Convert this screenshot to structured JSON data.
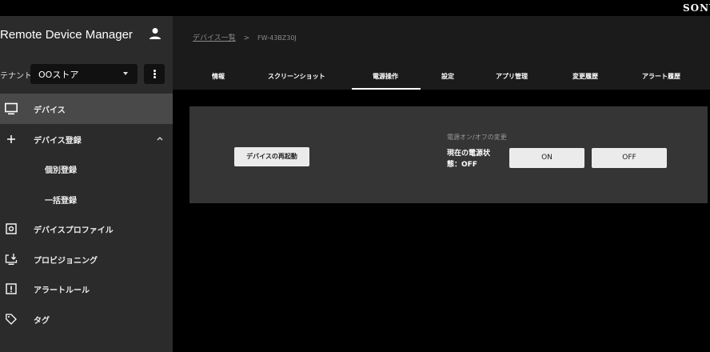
{
  "brand": "SONY",
  "app": {
    "title": "Remote Device Manager"
  },
  "tenant": {
    "label": "テナント:",
    "value": "OOストア"
  },
  "nav": {
    "items": [
      {
        "label": "デバイス",
        "icon": "monitor-icon"
      },
      {
        "label": "デバイス登録",
        "icon": "plus-icon"
      },
      {
        "label": "個別登録"
      },
      {
        "label": "一括登録"
      },
      {
        "label": "デバイスプロファイル",
        "icon": "settings-box-icon"
      },
      {
        "label": "プロビジョニング",
        "icon": "download-screen-icon"
      },
      {
        "label": "アラートルール",
        "icon": "alert-box-icon"
      },
      {
        "label": "タグ",
        "icon": "tag-icon"
      }
    ]
  },
  "breadcrumb": {
    "link": "デバイス一覧",
    "separator": ">",
    "current": "FW-43BZ30J"
  },
  "tabs": [
    "情報",
    "スクリーンショット",
    "電源操作",
    "設定",
    "アプリ管理",
    "変更履歴",
    "アラート履歴"
  ],
  "panel": {
    "restart_label": "デバイスの再起動",
    "power_title": "電源オン/オフの変更",
    "power_status": "現在の電源状態：OFF",
    "on_label": "ON",
    "off_label": "OFF"
  },
  "colors": {
    "sidebar": "#2b2b2b",
    "active_nav": "#494949",
    "panel": "#353535",
    "button": "#ebebeb"
  }
}
